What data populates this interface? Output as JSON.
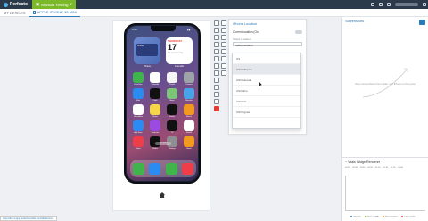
{
  "topbar": {
    "brand": "Perfecto",
    "manual_tab": "Manual Testing"
  },
  "tabs": [
    {
      "label": "MY DEVICES"
    },
    {
      "label": "APPLE IPHONE 13 MINI"
    }
  ],
  "phone": {
    "status_time": "9:41",
    "widgets": {
      "photos_text": "Photos",
      "calendar_day": "THURSDAY",
      "calendar_num": "17",
      "calendar_note": "No events today",
      "photos_label": "Photos",
      "calendar_label": "Calendar"
    },
    "apps": [
      {
        "label": "FaceTime",
        "color": "#3fb44a"
      },
      {
        "label": "Calendar",
        "color": "#ffffff"
      },
      {
        "label": "Photos",
        "color": "#f5f5f5"
      },
      {
        "label": "Camera",
        "color": "#9ea3a8"
      },
      {
        "label": "Mail",
        "color": "#2a8bf2"
      },
      {
        "label": "Clock",
        "color": "#111111"
      },
      {
        "label": "Maps",
        "color": "#7cc477"
      },
      {
        "label": "Weather",
        "color": "#4aa3e8"
      },
      {
        "label": "Reminders",
        "color": "#ffffff"
      },
      {
        "label": "Notes",
        "color": "#f6d54b"
      },
      {
        "label": "Stocks",
        "color": "#111111"
      },
      {
        "label": "Books",
        "color": "#f29a1f"
      },
      {
        "label": "App Store",
        "color": "#2a8bf2"
      },
      {
        "label": "Podcasts",
        "color": "#9b4be0"
      },
      {
        "label": "TV",
        "color": "#111111"
      },
      {
        "label": "Health",
        "color": "#ffffff"
      },
      {
        "label": "News",
        "color": "#ef3d4a"
      },
      {
        "label": "Wallet",
        "color": "#111111"
      },
      {
        "label": "Settings",
        "color": "#8e8e93"
      },
      {
        "label": "Home",
        "color": "#f29a1f"
      }
    ],
    "search_label": "Search",
    "dock": [
      {
        "label": "Phone",
        "color": "#3fb44a"
      },
      {
        "label": "Safari",
        "color": "#2a8bf2"
      },
      {
        "label": "Messages",
        "color": "#3fb44a"
      },
      {
        "label": "Music",
        "color": "#ef3d4a"
      }
    ]
  },
  "location_panel": {
    "title": "iPhone Location",
    "toggle_label": "Current location (On)",
    "field_label": "Select Location",
    "select_value": "Select location",
    "options": [
      "US",
      "US/California",
      "US/Colorado",
      "US/Idaho",
      "US/Utah",
      "US/Virginia"
    ]
  },
  "screenshots": {
    "title": "Screenshots",
    "empty_text": "Save screenshots from inside your iPhone to this pane"
  },
  "vitals": {
    "title": "Vitals",
    "process": "WidgetRenderer",
    "times": [
      "00:20",
      "00:30",
      "00:40",
      "00:50",
      "01:00",
      "01:10",
      "01:20",
      "01:30"
    ],
    "legend": [
      "CPU (%)",
      "Memory (MB)",
      "Network (Kb/s)",
      "Power (mW)"
    ]
  },
  "status_url": "https://demo.app.perfectomobile.com/lab/device/..."
}
